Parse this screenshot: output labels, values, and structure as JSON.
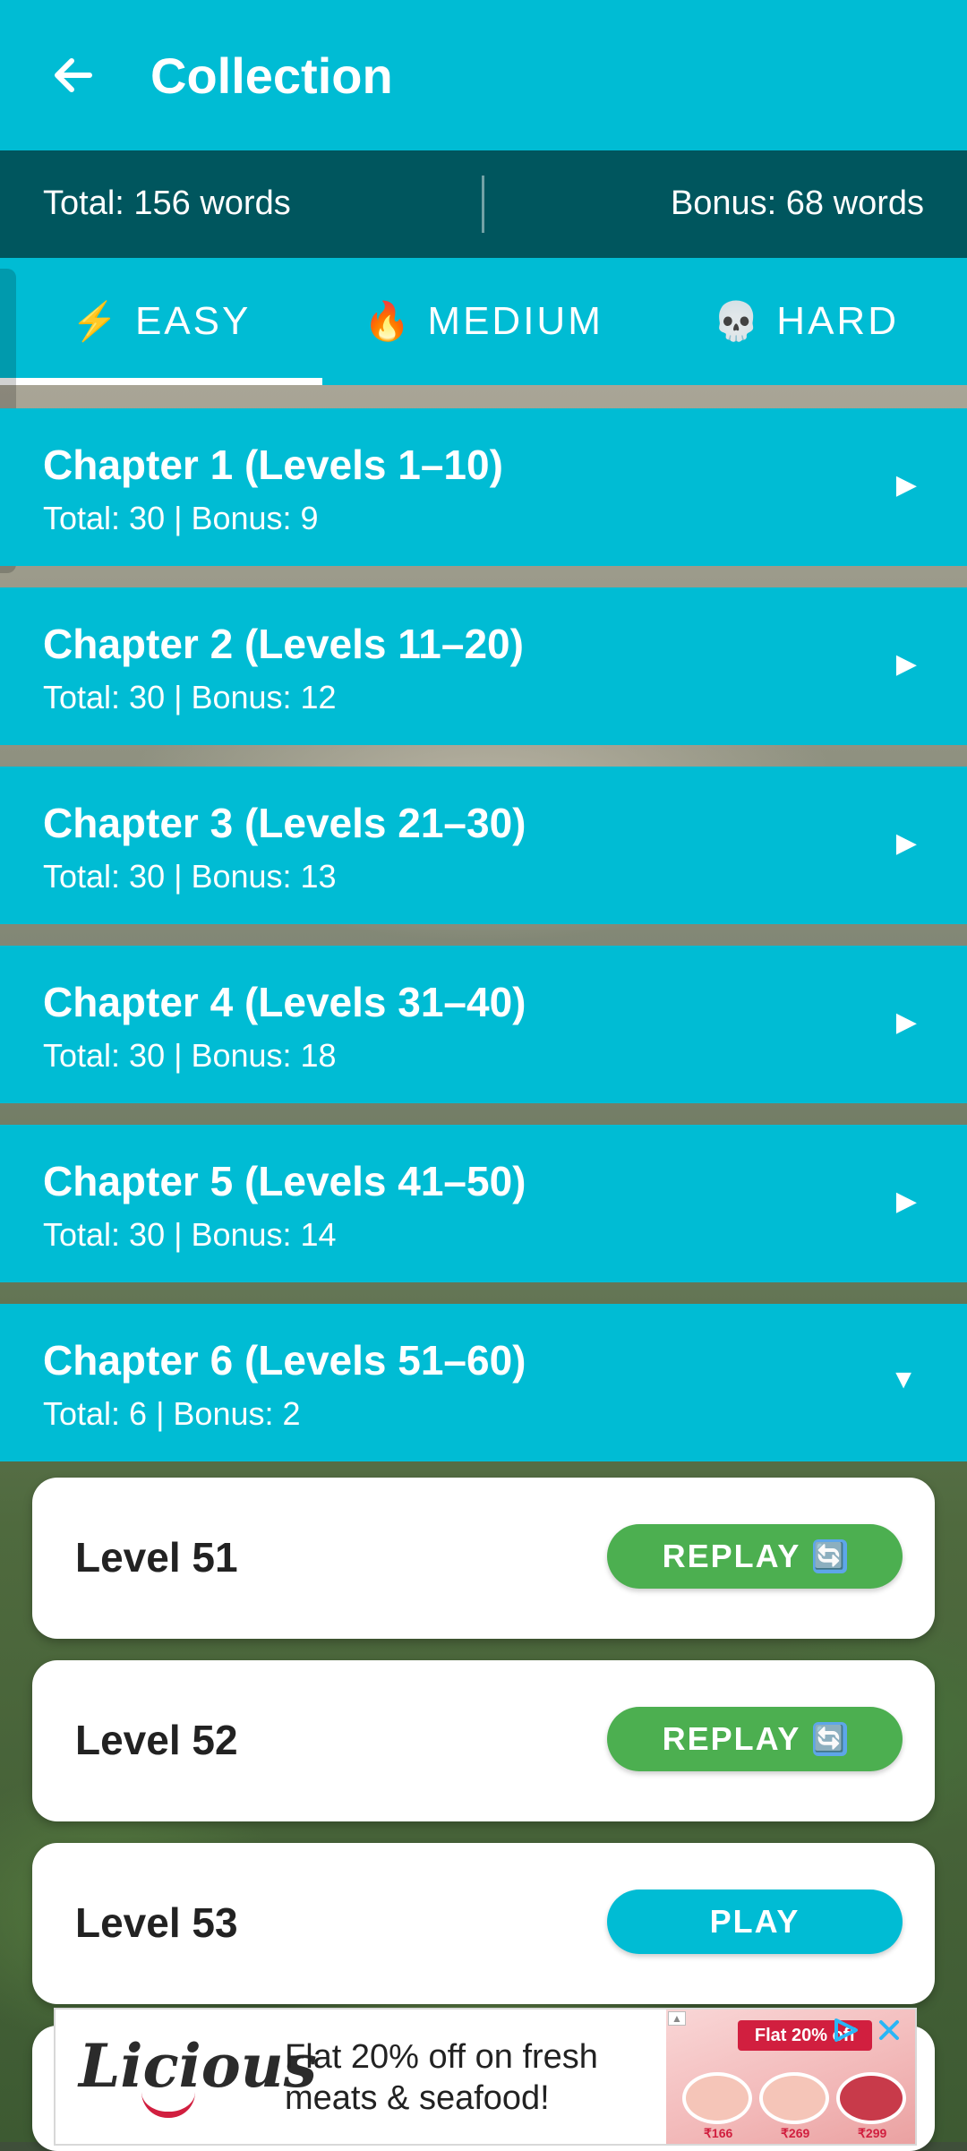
{
  "header": {
    "title": "Collection",
    "back_icon": "arrow-left-icon"
  },
  "stats": {
    "total": "Total: 156 words",
    "bonus": "Bonus: 68 words"
  },
  "tabs": [
    {
      "emoji": "⚡",
      "label": "EASY",
      "selected": true
    },
    {
      "emoji": "🔥",
      "label": "MEDIUM",
      "selected": false
    },
    {
      "emoji": "💀",
      "label": "HARD",
      "selected": false
    }
  ],
  "chapters": [
    {
      "title": "Chapter 1 (Levels 1–10)",
      "subtitle": "Total: 30 | Bonus: 9",
      "arrow": "▶"
    },
    {
      "title": "Chapter 2 (Levels 11–20)",
      "subtitle": "Total: 30 | Bonus: 12",
      "arrow": "▶"
    },
    {
      "title": "Chapter 3 (Levels 21–30)",
      "subtitle": "Total: 30 | Bonus: 13",
      "arrow": "▶"
    },
    {
      "title": "Chapter 4 (Levels 31–40)",
      "subtitle": "Total: 30 | Bonus: 18",
      "arrow": "▶"
    },
    {
      "title": "Chapter 5 (Levels 41–50)",
      "subtitle": "Total: 30 | Bonus: 14",
      "arrow": "▶"
    },
    {
      "title": "Chapter 6 (Levels 51–60)",
      "subtitle": "Total: 6 | Bonus: 2",
      "arrow": "▼"
    }
  ],
  "levels": [
    {
      "label": "Level 51",
      "button": "REPLAY",
      "icon": "🔄"
    },
    {
      "label": "Level 52",
      "button": "REPLAY",
      "icon": "🔄"
    },
    {
      "label": "Level 53",
      "button": "PLAY"
    }
  ],
  "ad": {
    "brand": "Licious",
    "text": "Flat 20% off on fresh meats & seafood!",
    "banner": "Flat 20% off",
    "prices": [
      "₹166",
      "₹269",
      "₹299"
    ],
    "badge": "▲"
  },
  "colors": {
    "primary": "#00bcd4",
    "stats_bar": "#00565e",
    "replay": "#4caf50",
    "brand_red": "#d11f3f"
  }
}
